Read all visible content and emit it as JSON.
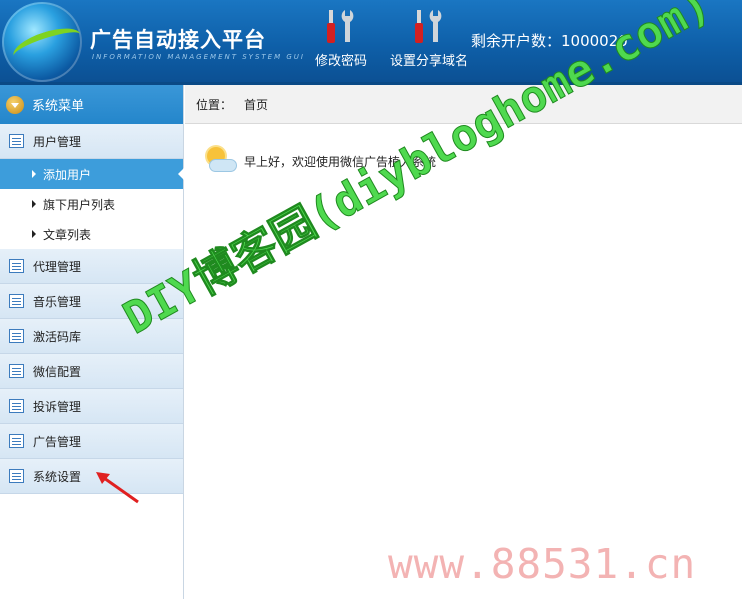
{
  "header": {
    "title": "广告自动接入平台",
    "subtitle": "INFORMATION MANAGEMENT SYSTEM GUI",
    "tools": [
      {
        "label": "修改密码",
        "icon": "tools-icon"
      },
      {
        "label": "设置分享域名",
        "icon": "tools-icon"
      }
    ],
    "remaining_label": "剩余开户数：1000020"
  },
  "sidebar": {
    "title": "系统菜单",
    "groups": [
      {
        "label": "用户管理",
        "expanded": true,
        "items": [
          {
            "label": "添加用户",
            "active": true
          },
          {
            "label": "旗下用户列表"
          },
          {
            "label": "文章列表"
          }
        ]
      },
      {
        "label": "代理管理"
      },
      {
        "label": "音乐管理"
      },
      {
        "label": "激活码库"
      },
      {
        "label": "微信配置"
      },
      {
        "label": "投诉管理"
      },
      {
        "label": "广告管理"
      },
      {
        "label": "系统设置"
      }
    ]
  },
  "breadcrumb": {
    "prefix": "位置：",
    "current": "首页"
  },
  "welcome": {
    "text": "早上好，欢迎使用微信广告植入系统"
  },
  "watermarks": {
    "main": "DIY博客园(diybloghome.com)",
    "url": "www.88531.cn"
  },
  "colors": {
    "header_bg": "#0e5fa8",
    "active_item": "#3d9ddb",
    "watermark_green": "#4fd94f",
    "watermark_pink": "#f3b3b3",
    "arrow_red": "#e02020"
  }
}
